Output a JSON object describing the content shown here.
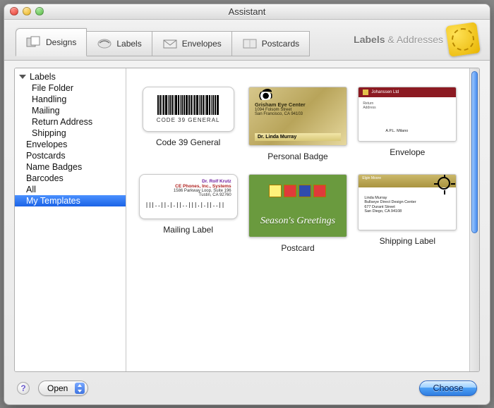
{
  "window": {
    "title": "Assistant"
  },
  "brand": {
    "label_bold": "Labels",
    "label_rest": " & Addresses"
  },
  "tabs": [
    {
      "label": "Designs",
      "icon": "designs-icon",
      "active": true
    },
    {
      "label": "Labels",
      "icon": "labels-icon",
      "active": false
    },
    {
      "label": "Envelopes",
      "icon": "envelopes-icon",
      "active": false
    },
    {
      "label": "Postcards",
      "icon": "postcards-icon",
      "active": false
    }
  ],
  "sidebar": {
    "root": "Labels",
    "labels_children": [
      "File Folder",
      "Handling",
      "Mailing",
      "Return Address",
      "Shipping"
    ],
    "top_level": [
      "Envelopes",
      "Postcards",
      "Name Badges",
      "Barcodes",
      "All",
      "My Templates"
    ],
    "selected": "My Templates"
  },
  "templates": [
    {
      "caption": "Code 39 General",
      "kind": "barcode",
      "barcode_text": "CODE 39 GENERAL"
    },
    {
      "caption": "Personal Badge",
      "kind": "gold-badge",
      "org": "Grisham Eye Center",
      "addr1": "1094 Folsom Street",
      "addr2": "San Francisco, CA 94103",
      "name": "Dr. Linda Murray"
    },
    {
      "caption": "Envelope",
      "kind": "envelope",
      "return_addr": "Johanssen Ltd",
      "to_name": "A.P.L. Milano"
    },
    {
      "caption": "Mailing Label",
      "kind": "mailing",
      "name": "Dr. Rolf Krutz",
      "company": "CE Phones, Inc., Systems",
      "street": "1586 Parkway Loop, Suite 196",
      "city": "Tustin, CA  92760",
      "barcode": "|||..||.|.||..|||.|.||..||"
    },
    {
      "caption": "Postcard",
      "kind": "postcard",
      "greeting": "Season's Greetings"
    },
    {
      "caption": "Shipping Label",
      "kind": "shipping",
      "from_name": "Elgin Moore",
      "to_name": "Linda Murray",
      "to_org": "Bullseye Direct Design Center",
      "to_street": "677 Durant Street",
      "to_city": "San Diego, CA 94108"
    }
  ],
  "footer": {
    "open_label": "Open",
    "choose_label": "Choose"
  }
}
